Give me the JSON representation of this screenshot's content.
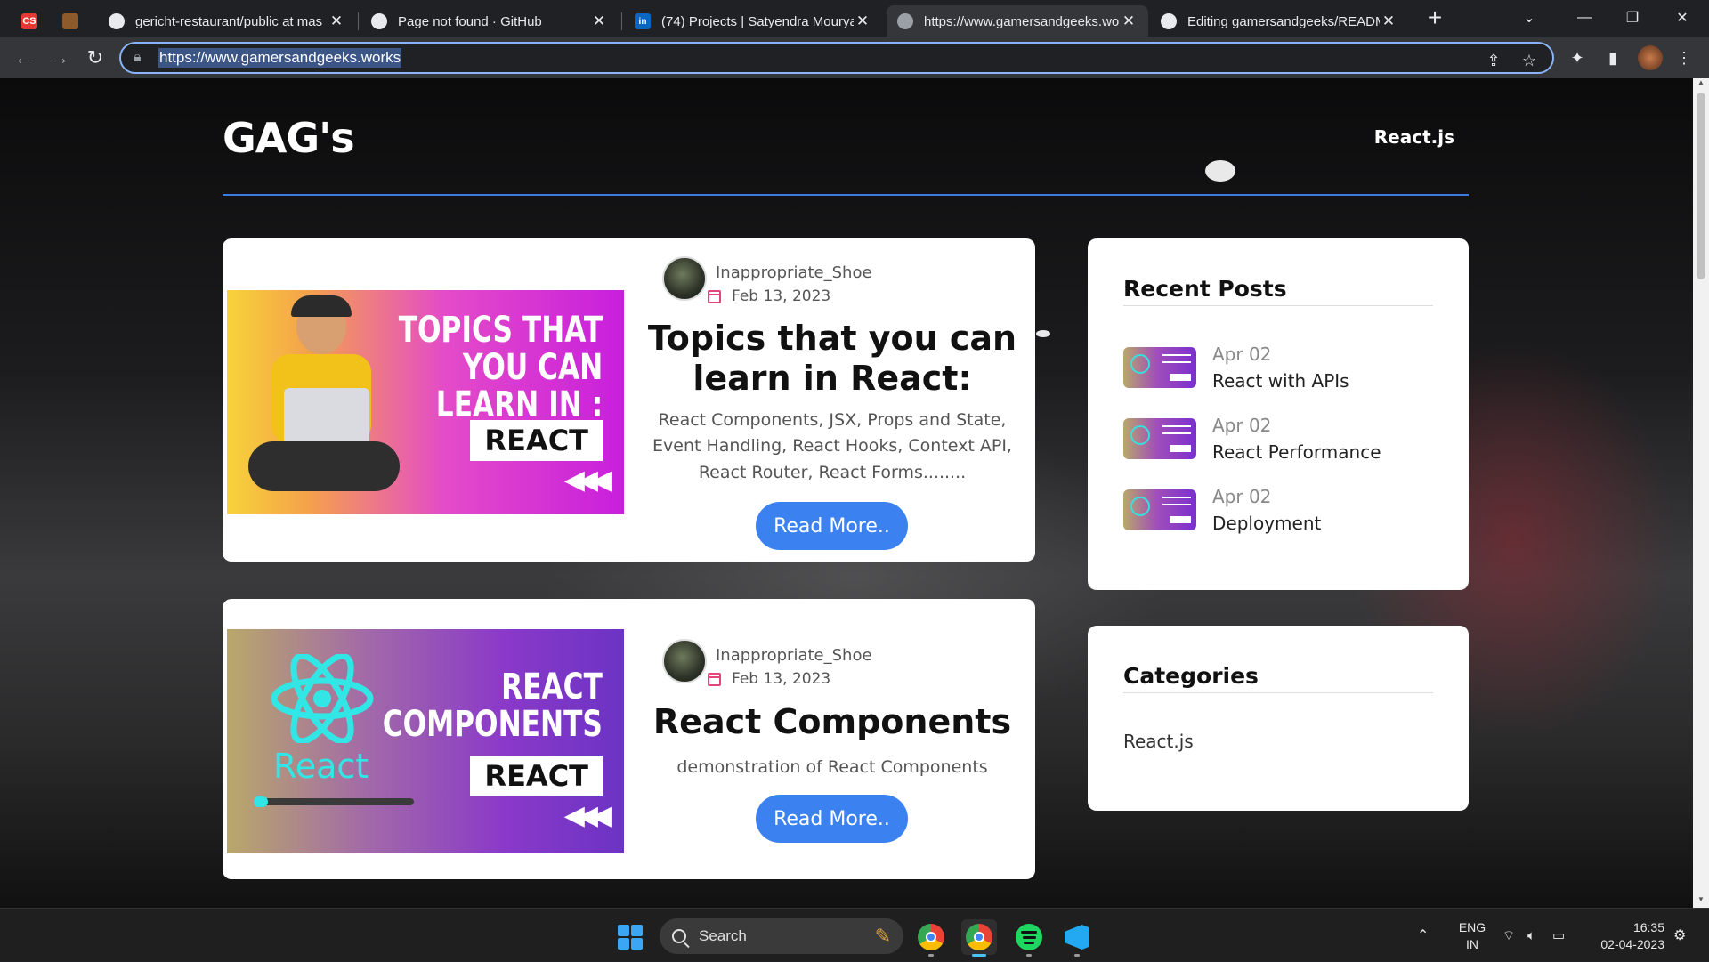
{
  "browser": {
    "tabs": [
      {
        "title": "",
        "icon": "red-app-icon"
      },
      {
        "title": "",
        "icon": "brown-app-icon"
      },
      {
        "title": "gericht-restaurant/public at mas",
        "icon": "github-icon"
      },
      {
        "title": "Page not found · GitHub",
        "icon": "github-icon"
      },
      {
        "title": "(74) Projects | Satyendra Mourya",
        "icon": "linkedin-icon"
      },
      {
        "title": "https://www.gamersandgeeks.wo",
        "icon": "globe-icon"
      },
      {
        "title": "Editing gamersandgeeks/READM",
        "icon": "github-icon"
      }
    ],
    "active_tab_index": 5,
    "url": "https://www.gamersandgeeks.works"
  },
  "site": {
    "brand": "GAG's",
    "nav_link": "React.js",
    "accent": "#3b82f0"
  },
  "posts": [
    {
      "author": "Inappropriate_Shoe",
      "date": "Feb 13, 2023",
      "title": "Topics that you can learn in React:",
      "excerpt": "React Components, JSX, Props and State, Event Handling, React Hooks, Context API, React Router, React Forms........",
      "button": "Read More..",
      "thumb_lines": [
        "TOPICS THAT",
        "YOU CAN",
        "LEARN IN :"
      ],
      "thumb_tag": "REACT"
    },
    {
      "author": "Inappropriate_Shoe",
      "date": "Feb 13, 2023",
      "title": "React Components",
      "excerpt": "demonstration of React Components",
      "button": "Read More..",
      "thumb_lines": [
        "REACT",
        "COMPONENTS"
      ],
      "thumb_tag": "REACT",
      "thumb_logo_text": "React"
    }
  ],
  "sidebar": {
    "recent_heading": "Recent Posts",
    "recent": [
      {
        "date": "Apr 02",
        "title": "React with APIs"
      },
      {
        "date": "Apr 02",
        "title": "React Performance"
      },
      {
        "date": "Apr 02",
        "title": "Deployment"
      }
    ],
    "categories_heading": "Categories",
    "categories": [
      "React.js"
    ]
  },
  "taskbar": {
    "search_label": "Search",
    "lang_top": "ENG",
    "lang_bottom": "IN",
    "time": "16:35",
    "date": "02-04-2023"
  }
}
